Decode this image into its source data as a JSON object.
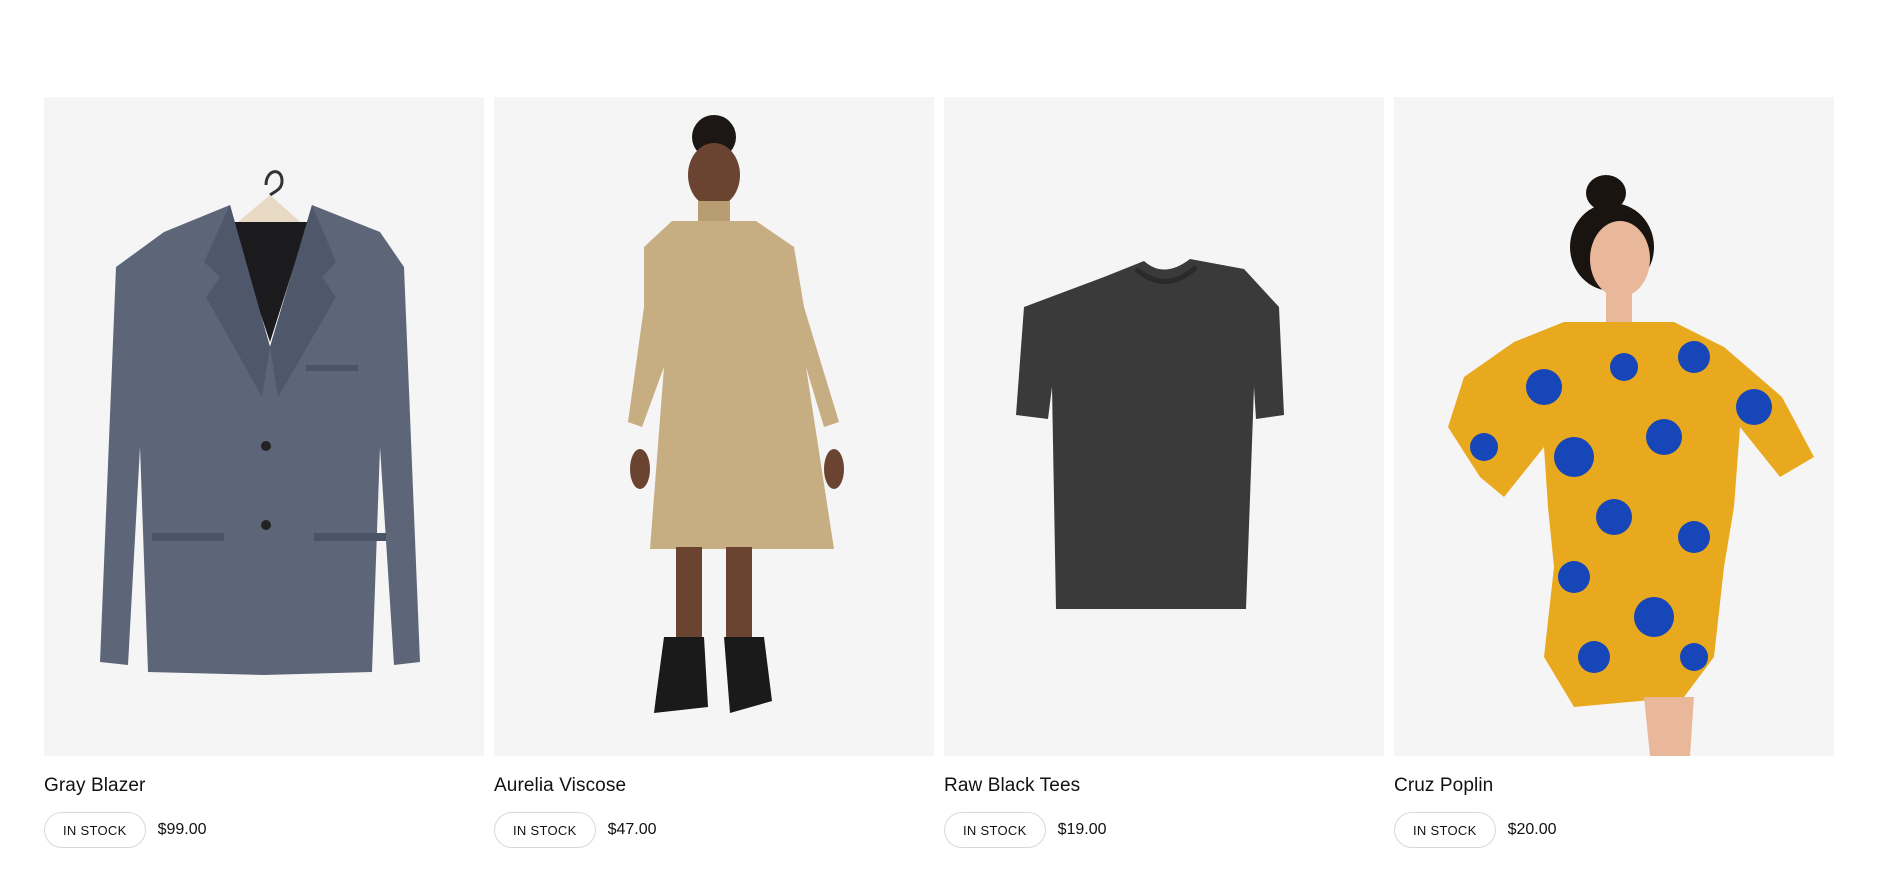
{
  "products": [
    {
      "name": "Gray Blazer",
      "stock": "IN STOCK",
      "price": "$99.00",
      "image_icon": "gray-blazer-image"
    },
    {
      "name": "Aurelia Viscose",
      "stock": "IN STOCK",
      "price": "$47.00",
      "image_icon": "beige-dress-model-image"
    },
    {
      "name": "Raw Black Tees",
      "stock": "IN STOCK",
      "price": "$19.00",
      "image_icon": "black-tshirt-image"
    },
    {
      "name": "Cruz Poplin",
      "stock": "IN STOCK",
      "price": "$20.00",
      "image_icon": "floral-dress-model-image"
    }
  ],
  "colors": {
    "card_bg": "#f5f5f5",
    "blazer": "#5c6577",
    "dress_beige": "#c7ad82",
    "tee": "#3a3a3a",
    "floral_yellow": "#e9a91f",
    "floral_blue": "#1646b8"
  }
}
